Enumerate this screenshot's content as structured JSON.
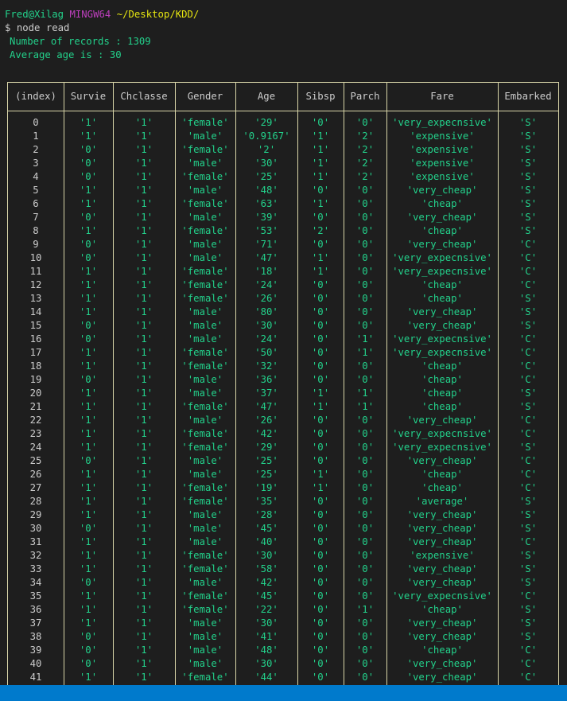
{
  "prompt": {
    "user": "Fred@Xilag",
    "env": "MINGW64",
    "path": "~/Desktop/KDD/",
    "symbol": "$",
    "command": "node read"
  },
  "output": {
    "records_line": "Number of records : 1309",
    "age_line": "Average age is : 30"
  },
  "colors": {
    "background": "#1e1e1e",
    "string_green": "#23d18b",
    "index_text": "#cccccc",
    "border": "#d8d5a8",
    "statusbar": "#007acc",
    "prompt_magenta": "#bc3fbc",
    "prompt_yellow": "#e5e510"
  },
  "table": {
    "headers": [
      "(index)",
      "Survie",
      "Chclasse",
      "Gender",
      "Age",
      "Sibsp",
      "Parch",
      "Fare",
      "Embarked"
    ],
    "rows": [
      [
        "0",
        "'1'",
        "'1'",
        "'female'",
        "'29'",
        "'0'",
        "'0'",
        "'very_expecnsive'",
        "'S'"
      ],
      [
        "1",
        "'1'",
        "'1'",
        "'male'",
        "'0.9167'",
        "'1'",
        "'2'",
        "'expensive'",
        "'S'"
      ],
      [
        "2",
        "'0'",
        "'1'",
        "'female'",
        "'2'",
        "'1'",
        "'2'",
        "'expensive'",
        "'S'"
      ],
      [
        "3",
        "'0'",
        "'1'",
        "'male'",
        "'30'",
        "'1'",
        "'2'",
        "'expensive'",
        "'S'"
      ],
      [
        "4",
        "'0'",
        "'1'",
        "'female'",
        "'25'",
        "'1'",
        "'2'",
        "'expensive'",
        "'S'"
      ],
      [
        "5",
        "'1'",
        "'1'",
        "'male'",
        "'48'",
        "'0'",
        "'0'",
        "'very_cheap'",
        "'S'"
      ],
      [
        "6",
        "'1'",
        "'1'",
        "'female'",
        "'63'",
        "'1'",
        "'0'",
        "'cheap'",
        "'S'"
      ],
      [
        "7",
        "'0'",
        "'1'",
        "'male'",
        "'39'",
        "'0'",
        "'0'",
        "'very_cheap'",
        "'S'"
      ],
      [
        "8",
        "'1'",
        "'1'",
        "'female'",
        "'53'",
        "'2'",
        "'0'",
        "'cheap'",
        "'S'"
      ],
      [
        "9",
        "'0'",
        "'1'",
        "'male'",
        "'71'",
        "'0'",
        "'0'",
        "'very_cheap'",
        "'C'"
      ],
      [
        "10",
        "'0'",
        "'1'",
        "'male'",
        "'47'",
        "'1'",
        "'0'",
        "'very_expecnsive'",
        "'C'"
      ],
      [
        "11",
        "'1'",
        "'1'",
        "'female'",
        "'18'",
        "'1'",
        "'0'",
        "'very_expecnsive'",
        "'C'"
      ],
      [
        "12",
        "'1'",
        "'1'",
        "'female'",
        "'24'",
        "'0'",
        "'0'",
        "'cheap'",
        "'C'"
      ],
      [
        "13",
        "'1'",
        "'1'",
        "'female'",
        "'26'",
        "'0'",
        "'0'",
        "'cheap'",
        "'S'"
      ],
      [
        "14",
        "'1'",
        "'1'",
        "'male'",
        "'80'",
        "'0'",
        "'0'",
        "'very_cheap'",
        "'S'"
      ],
      [
        "15",
        "'0'",
        "'1'",
        "'male'",
        "'30'",
        "'0'",
        "'0'",
        "'very_cheap'",
        "'S'"
      ],
      [
        "16",
        "'0'",
        "'1'",
        "'male'",
        "'24'",
        "'0'",
        "'1'",
        "'very_expecnsive'",
        "'C'"
      ],
      [
        "17",
        "'1'",
        "'1'",
        "'female'",
        "'50'",
        "'0'",
        "'1'",
        "'very_expecnsive'",
        "'C'"
      ],
      [
        "18",
        "'1'",
        "'1'",
        "'female'",
        "'32'",
        "'0'",
        "'0'",
        "'cheap'",
        "'C'"
      ],
      [
        "19",
        "'0'",
        "'1'",
        "'male'",
        "'36'",
        "'0'",
        "'0'",
        "'cheap'",
        "'C'"
      ],
      [
        "20",
        "'1'",
        "'1'",
        "'male'",
        "'37'",
        "'1'",
        "'1'",
        "'cheap'",
        "'S'"
      ],
      [
        "21",
        "'1'",
        "'1'",
        "'female'",
        "'47'",
        "'1'",
        "'1'",
        "'cheap'",
        "'S'"
      ],
      [
        "22",
        "'1'",
        "'1'",
        "'male'",
        "'26'",
        "'0'",
        "'0'",
        "'very_cheap'",
        "'C'"
      ],
      [
        "23",
        "'1'",
        "'1'",
        "'female'",
        "'42'",
        "'0'",
        "'0'",
        "'very_expecnsive'",
        "'C'"
      ],
      [
        "24",
        "'1'",
        "'1'",
        "'female'",
        "'29'",
        "'0'",
        "'0'",
        "'very_expecnsive'",
        "'S'"
      ],
      [
        "25",
        "'0'",
        "'1'",
        "'male'",
        "'25'",
        "'0'",
        "'0'",
        "'very_cheap'",
        "'C'"
      ],
      [
        "26",
        "'1'",
        "'1'",
        "'male'",
        "'25'",
        "'1'",
        "'0'",
        "'cheap'",
        "'C'"
      ],
      [
        "27",
        "'1'",
        "'1'",
        "'female'",
        "'19'",
        "'1'",
        "'0'",
        "'cheap'",
        "'C'"
      ],
      [
        "28",
        "'1'",
        "'1'",
        "'female'",
        "'35'",
        "'0'",
        "'0'",
        "'average'",
        "'S'"
      ],
      [
        "29",
        "'1'",
        "'1'",
        "'male'",
        "'28'",
        "'0'",
        "'0'",
        "'very_cheap'",
        "'S'"
      ],
      [
        "30",
        "'0'",
        "'1'",
        "'male'",
        "'45'",
        "'0'",
        "'0'",
        "'very_cheap'",
        "'S'"
      ],
      [
        "31",
        "'1'",
        "'1'",
        "'male'",
        "'40'",
        "'0'",
        "'0'",
        "'very_cheap'",
        "'C'"
      ],
      [
        "32",
        "'1'",
        "'1'",
        "'female'",
        "'30'",
        "'0'",
        "'0'",
        "'expensive'",
        "'S'"
      ],
      [
        "33",
        "'1'",
        "'1'",
        "'female'",
        "'58'",
        "'0'",
        "'0'",
        "'very_cheap'",
        "'S'"
      ],
      [
        "34",
        "'0'",
        "'1'",
        "'male'",
        "'42'",
        "'0'",
        "'0'",
        "'very_cheap'",
        "'S'"
      ],
      [
        "35",
        "'1'",
        "'1'",
        "'female'",
        "'45'",
        "'0'",
        "'0'",
        "'very_expecnsive'",
        "'C'"
      ],
      [
        "36",
        "'1'",
        "'1'",
        "'female'",
        "'22'",
        "'0'",
        "'1'",
        "'cheap'",
        "'S'"
      ],
      [
        "37",
        "'1'",
        "'1'",
        "'male'",
        "'30'",
        "'0'",
        "'0'",
        "'very_cheap'",
        "'S'"
      ],
      [
        "38",
        "'0'",
        "'1'",
        "'male'",
        "'41'",
        "'0'",
        "'0'",
        "'very_cheap'",
        "'S'"
      ],
      [
        "39",
        "'0'",
        "'1'",
        "'male'",
        "'48'",
        "'0'",
        "'0'",
        "'cheap'",
        "'C'"
      ],
      [
        "40",
        "'0'",
        "'1'",
        "'male'",
        "'30'",
        "'0'",
        "'0'",
        "'very_cheap'",
        "'C'"
      ],
      [
        "41",
        "'1'",
        "'1'",
        "'female'",
        "'44'",
        "'0'",
        "'0'",
        "'very_cheap'",
        "'C'"
      ]
    ]
  }
}
